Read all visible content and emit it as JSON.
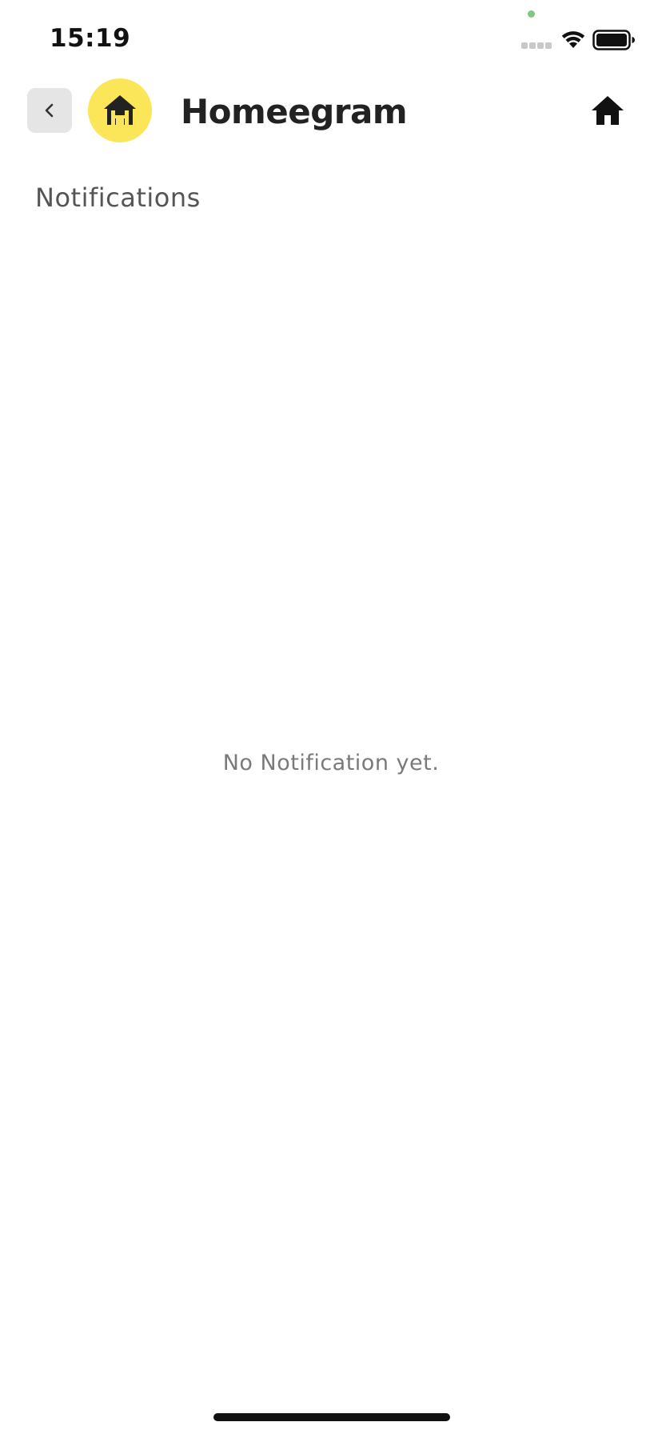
{
  "status_bar": {
    "time": "15:19",
    "icons": [
      "signal-icon",
      "wifi-icon",
      "battery-icon"
    ],
    "privacy_dot_color": "#7ec97f"
  },
  "header": {
    "back_icon": "chevron-left-icon",
    "logo_icon": "homeegram-logo-icon",
    "logo_color": "#fbe65a",
    "title": "Homeegram",
    "home_icon": "home-icon"
  },
  "page": {
    "heading": "Notifications",
    "empty_message": "No Notification yet."
  },
  "colors": {
    "background": "#ffffff",
    "text_primary": "#222222",
    "text_secondary": "#555555",
    "text_muted": "#7a7a7a",
    "back_button_bg": "#e5e5e5"
  }
}
